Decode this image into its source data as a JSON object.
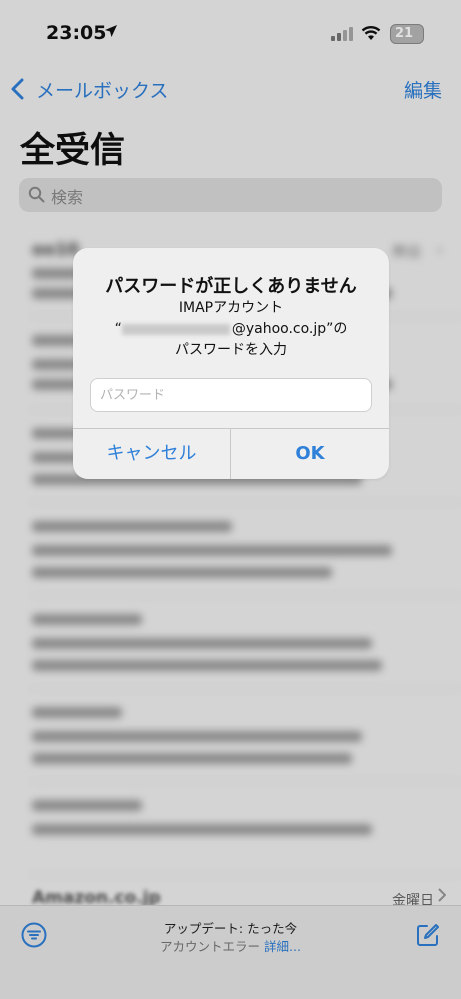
{
  "status_bar": {
    "time": "23:05",
    "battery": "21"
  },
  "nav": {
    "back_label": "メールボックス",
    "edit_label": "編集",
    "title": "全受信"
  },
  "search": {
    "placeholder": "検索"
  },
  "mail_list": [
    {
      "sender": "oo10",
      "date": "昨日"
    },
    {
      "sender": "",
      "date": ""
    },
    {
      "sender": "",
      "date": ""
    },
    {
      "sender": "",
      "date": ""
    },
    {
      "sender": "",
      "date": ""
    },
    {
      "sender": "",
      "date": ""
    },
    {
      "sender": "",
      "date": ""
    }
  ],
  "bottom_mail": {
    "sender": "Amazon.co.jp",
    "date": "金曜日"
  },
  "toolbar": {
    "update_text": "アップデート: たった今",
    "error_text": "アカウントエラー",
    "detail_link": "詳細..."
  },
  "alert": {
    "title": "パスワードが正しくありません",
    "message_line1": "IMAPアカウント",
    "message_open_quote": "“",
    "message_email_domain": "@yahoo.co.jp",
    "message_close_quote": "”の",
    "message_line3": "パスワードを入力",
    "password_placeholder": "パスワード",
    "cancel_label": "キャンセル",
    "ok_label": "OK"
  },
  "colors": {
    "accent": "#2f80d9",
    "background": "#f2f2f2",
    "alert_bg": "#efefef"
  }
}
